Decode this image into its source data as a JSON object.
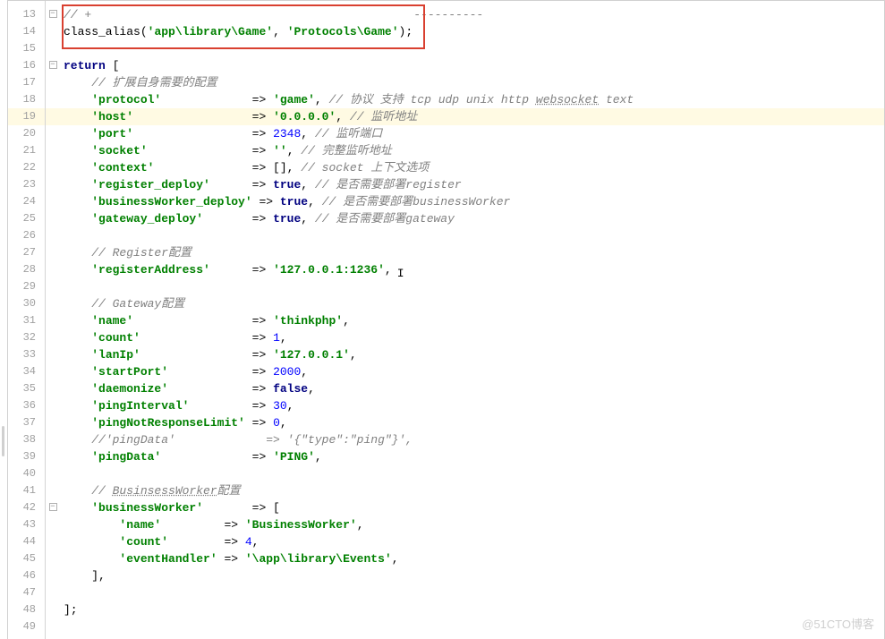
{
  "watermark": "@51CTO博客",
  "lines": [
    {
      "n": 13,
      "fold": "-",
      "tokens": [
        {
          "t": "// +",
          "cls": "cmt"
        },
        {
          "t": "----------",
          "cls": "cmt sep"
        }
      ]
    },
    {
      "n": 14,
      "fold": "",
      "tokens": [
        {
          "t": "class_alias",
          "cls": "fn"
        },
        {
          "t": "(",
          "cls": "pun"
        },
        {
          "t": "'app\\library\\Game'",
          "cls": "str"
        },
        {
          "t": ", ",
          "cls": "pun"
        },
        {
          "t": "'Protocols\\Game'",
          "cls": "str"
        },
        {
          "t": ");",
          "cls": "pun"
        }
      ]
    },
    {
      "n": 15,
      "fold": "",
      "tokens": []
    },
    {
      "n": 16,
      "fold": "-",
      "tokens": [
        {
          "t": "return",
          "cls": "kw"
        },
        {
          "t": " [",
          "cls": "pun"
        }
      ]
    },
    {
      "n": 17,
      "fold": "",
      "tokens": [
        {
          "t": "    ",
          "cls": ""
        },
        {
          "t": "// 扩展自身需要的配置",
          "cls": "cmt"
        }
      ]
    },
    {
      "n": 18,
      "fold": "",
      "tokens": [
        {
          "t": "    ",
          "cls": ""
        },
        {
          "t": "'protocol'",
          "cls": "str"
        },
        {
          "t": "             => ",
          "cls": "pun"
        },
        {
          "t": "'game'",
          "cls": "str"
        },
        {
          "t": ", ",
          "cls": "pun"
        },
        {
          "t": "// 协议 支持 tcp udp unix http ",
          "cls": "cmt"
        },
        {
          "t": "websocket",
          "cls": "cmt cmt-under"
        },
        {
          "t": " text",
          "cls": "cmt"
        }
      ]
    },
    {
      "n": 19,
      "fold": "",
      "hl": true,
      "tokens": [
        {
          "t": "    ",
          "cls": ""
        },
        {
          "t": "'host'",
          "cls": "str"
        },
        {
          "t": "                 => ",
          "cls": "pun"
        },
        {
          "t": "'0.0.0.0'",
          "cls": "str"
        },
        {
          "t": ", ",
          "cls": "pun"
        },
        {
          "t": "// 监听地址",
          "cls": "cmt"
        }
      ]
    },
    {
      "n": 20,
      "fold": "",
      "tokens": [
        {
          "t": "    ",
          "cls": ""
        },
        {
          "t": "'port'",
          "cls": "str"
        },
        {
          "t": "                 => ",
          "cls": "pun"
        },
        {
          "t": "2348",
          "cls": "num"
        },
        {
          "t": ", ",
          "cls": "pun"
        },
        {
          "t": "// 监听端口",
          "cls": "cmt"
        }
      ]
    },
    {
      "n": 21,
      "fold": "",
      "tokens": [
        {
          "t": "    ",
          "cls": ""
        },
        {
          "t": "'socket'",
          "cls": "str"
        },
        {
          "t": "               => ",
          "cls": "pun"
        },
        {
          "t": "''",
          "cls": "str"
        },
        {
          "t": ", ",
          "cls": "pun"
        },
        {
          "t": "// 完整监听地址",
          "cls": "cmt"
        }
      ]
    },
    {
      "n": 22,
      "fold": "",
      "tokens": [
        {
          "t": "    ",
          "cls": ""
        },
        {
          "t": "'context'",
          "cls": "str"
        },
        {
          "t": "              => [], ",
          "cls": "pun"
        },
        {
          "t": "// socket 上下文选项",
          "cls": "cmt"
        }
      ]
    },
    {
      "n": 23,
      "fold": "",
      "tokens": [
        {
          "t": "    ",
          "cls": ""
        },
        {
          "t": "'register_deploy'",
          "cls": "str"
        },
        {
          "t": "      => ",
          "cls": "pun"
        },
        {
          "t": "true",
          "cls": "kw"
        },
        {
          "t": ", ",
          "cls": "pun"
        },
        {
          "t": "// 是否需要部署register",
          "cls": "cmt"
        }
      ]
    },
    {
      "n": 24,
      "fold": "",
      "tokens": [
        {
          "t": "    ",
          "cls": ""
        },
        {
          "t": "'businessWorker_deploy'",
          "cls": "str"
        },
        {
          "t": " => ",
          "cls": "pun"
        },
        {
          "t": "true",
          "cls": "kw"
        },
        {
          "t": ", ",
          "cls": "pun"
        },
        {
          "t": "// 是否需要部署businessWorker",
          "cls": "cmt"
        }
      ]
    },
    {
      "n": 25,
      "fold": "",
      "tokens": [
        {
          "t": "    ",
          "cls": ""
        },
        {
          "t": "'gateway_deploy'",
          "cls": "str"
        },
        {
          "t": "       => ",
          "cls": "pun"
        },
        {
          "t": "true",
          "cls": "kw"
        },
        {
          "t": ", ",
          "cls": "pun"
        },
        {
          "t": "// 是否需要部署gateway",
          "cls": "cmt"
        }
      ]
    },
    {
      "n": 26,
      "fold": "",
      "tokens": []
    },
    {
      "n": 27,
      "fold": "",
      "tokens": [
        {
          "t": "    ",
          "cls": ""
        },
        {
          "t": "// Register配置",
          "cls": "cmt"
        }
      ]
    },
    {
      "n": 28,
      "fold": "",
      "tokens": [
        {
          "t": "    ",
          "cls": ""
        },
        {
          "t": "'registerAddress'",
          "cls": "str"
        },
        {
          "t": "      => ",
          "cls": "pun"
        },
        {
          "t": "'127.0.0.1:1236'",
          "cls": "str"
        },
        {
          "t": ",",
          "cls": "pun"
        }
      ],
      "caret": true
    },
    {
      "n": 29,
      "fold": "",
      "tokens": []
    },
    {
      "n": 30,
      "fold": "",
      "tokens": [
        {
          "t": "    ",
          "cls": ""
        },
        {
          "t": "// Gateway配置",
          "cls": "cmt"
        }
      ]
    },
    {
      "n": 31,
      "fold": "",
      "tokens": [
        {
          "t": "    ",
          "cls": ""
        },
        {
          "t": "'name'",
          "cls": "str"
        },
        {
          "t": "                 => ",
          "cls": "pun"
        },
        {
          "t": "'thinkphp'",
          "cls": "str"
        },
        {
          "t": ",",
          "cls": "pun"
        }
      ]
    },
    {
      "n": 32,
      "fold": "",
      "tokens": [
        {
          "t": "    ",
          "cls": ""
        },
        {
          "t": "'count'",
          "cls": "str"
        },
        {
          "t": "                => ",
          "cls": "pun"
        },
        {
          "t": "1",
          "cls": "num"
        },
        {
          "t": ",",
          "cls": "pun"
        }
      ]
    },
    {
      "n": 33,
      "fold": "",
      "tokens": [
        {
          "t": "    ",
          "cls": ""
        },
        {
          "t": "'lanIp'",
          "cls": "str"
        },
        {
          "t": "                => ",
          "cls": "pun"
        },
        {
          "t": "'127.0.0.1'",
          "cls": "str"
        },
        {
          "t": ",",
          "cls": "pun"
        }
      ]
    },
    {
      "n": 34,
      "fold": "",
      "tokens": [
        {
          "t": "    ",
          "cls": ""
        },
        {
          "t": "'startPort'",
          "cls": "str"
        },
        {
          "t": "            => ",
          "cls": "pun"
        },
        {
          "t": "2000",
          "cls": "num"
        },
        {
          "t": ",",
          "cls": "pun"
        }
      ]
    },
    {
      "n": 35,
      "fold": "",
      "tokens": [
        {
          "t": "    ",
          "cls": ""
        },
        {
          "t": "'daemonize'",
          "cls": "str"
        },
        {
          "t": "            => ",
          "cls": "pun"
        },
        {
          "t": "false",
          "cls": "kw"
        },
        {
          "t": ",",
          "cls": "pun"
        }
      ]
    },
    {
      "n": 36,
      "fold": "",
      "tokens": [
        {
          "t": "    ",
          "cls": ""
        },
        {
          "t": "'pingInterval'",
          "cls": "str"
        },
        {
          "t": "         => ",
          "cls": "pun"
        },
        {
          "t": "30",
          "cls": "num"
        },
        {
          "t": ",",
          "cls": "pun"
        }
      ]
    },
    {
      "n": 37,
      "fold": "",
      "tokens": [
        {
          "t": "    ",
          "cls": ""
        },
        {
          "t": "'pingNotResponseLimit'",
          "cls": "str"
        },
        {
          "t": " => ",
          "cls": "pun"
        },
        {
          "t": "0",
          "cls": "num"
        },
        {
          "t": ",",
          "cls": "pun"
        }
      ]
    },
    {
      "n": 38,
      "fold": "",
      "tokens": [
        {
          "t": "    ",
          "cls": ""
        },
        {
          "t": "//'pingData'             => '{\"type\":\"ping\"}',",
          "cls": "cmt"
        }
      ]
    },
    {
      "n": 39,
      "fold": "",
      "tokens": [
        {
          "t": "    ",
          "cls": ""
        },
        {
          "t": "'pingData'",
          "cls": "str"
        },
        {
          "t": "             => ",
          "cls": "pun"
        },
        {
          "t": "'PING'",
          "cls": "str"
        },
        {
          "t": ",",
          "cls": "pun"
        }
      ]
    },
    {
      "n": 40,
      "fold": "",
      "tokens": []
    },
    {
      "n": 41,
      "fold": "",
      "tokens": [
        {
          "t": "    ",
          "cls": ""
        },
        {
          "t": "// ",
          "cls": "cmt"
        },
        {
          "t": "BusinsessWorker",
          "cls": "cmt cmt-under"
        },
        {
          "t": "配置",
          "cls": "cmt"
        }
      ]
    },
    {
      "n": 42,
      "fold": "-",
      "tokens": [
        {
          "t": "    ",
          "cls": ""
        },
        {
          "t": "'businessWorker'",
          "cls": "str"
        },
        {
          "t": "       => [",
          "cls": "pun"
        }
      ]
    },
    {
      "n": 43,
      "fold": "",
      "tokens": [
        {
          "t": "        ",
          "cls": ""
        },
        {
          "t": "'name'",
          "cls": "str"
        },
        {
          "t": "         => ",
          "cls": "pun"
        },
        {
          "t": "'BusinessWorker'",
          "cls": "str"
        },
        {
          "t": ",",
          "cls": "pun"
        }
      ]
    },
    {
      "n": 44,
      "fold": "",
      "tokens": [
        {
          "t": "        ",
          "cls": ""
        },
        {
          "t": "'count'",
          "cls": "str"
        },
        {
          "t": "        => ",
          "cls": "pun"
        },
        {
          "t": "4",
          "cls": "num"
        },
        {
          "t": ",",
          "cls": "pun"
        }
      ]
    },
    {
      "n": 45,
      "fold": "",
      "tokens": [
        {
          "t": "        ",
          "cls": ""
        },
        {
          "t": "'eventHandler'",
          "cls": "str"
        },
        {
          "t": " => ",
          "cls": "pun"
        },
        {
          "t": "'\\app\\library\\Events'",
          "cls": "str"
        },
        {
          "t": ",",
          "cls": "pun"
        }
      ]
    },
    {
      "n": 46,
      "fold": "end",
      "tokens": [
        {
          "t": "    ],",
          "cls": "pun"
        }
      ]
    },
    {
      "n": 47,
      "fold": "",
      "tokens": []
    },
    {
      "n": 48,
      "fold": "end",
      "tokens": [
        {
          "t": "];",
          "cls": "pun"
        }
      ]
    },
    {
      "n": 49,
      "fold": "",
      "tokens": []
    }
  ]
}
